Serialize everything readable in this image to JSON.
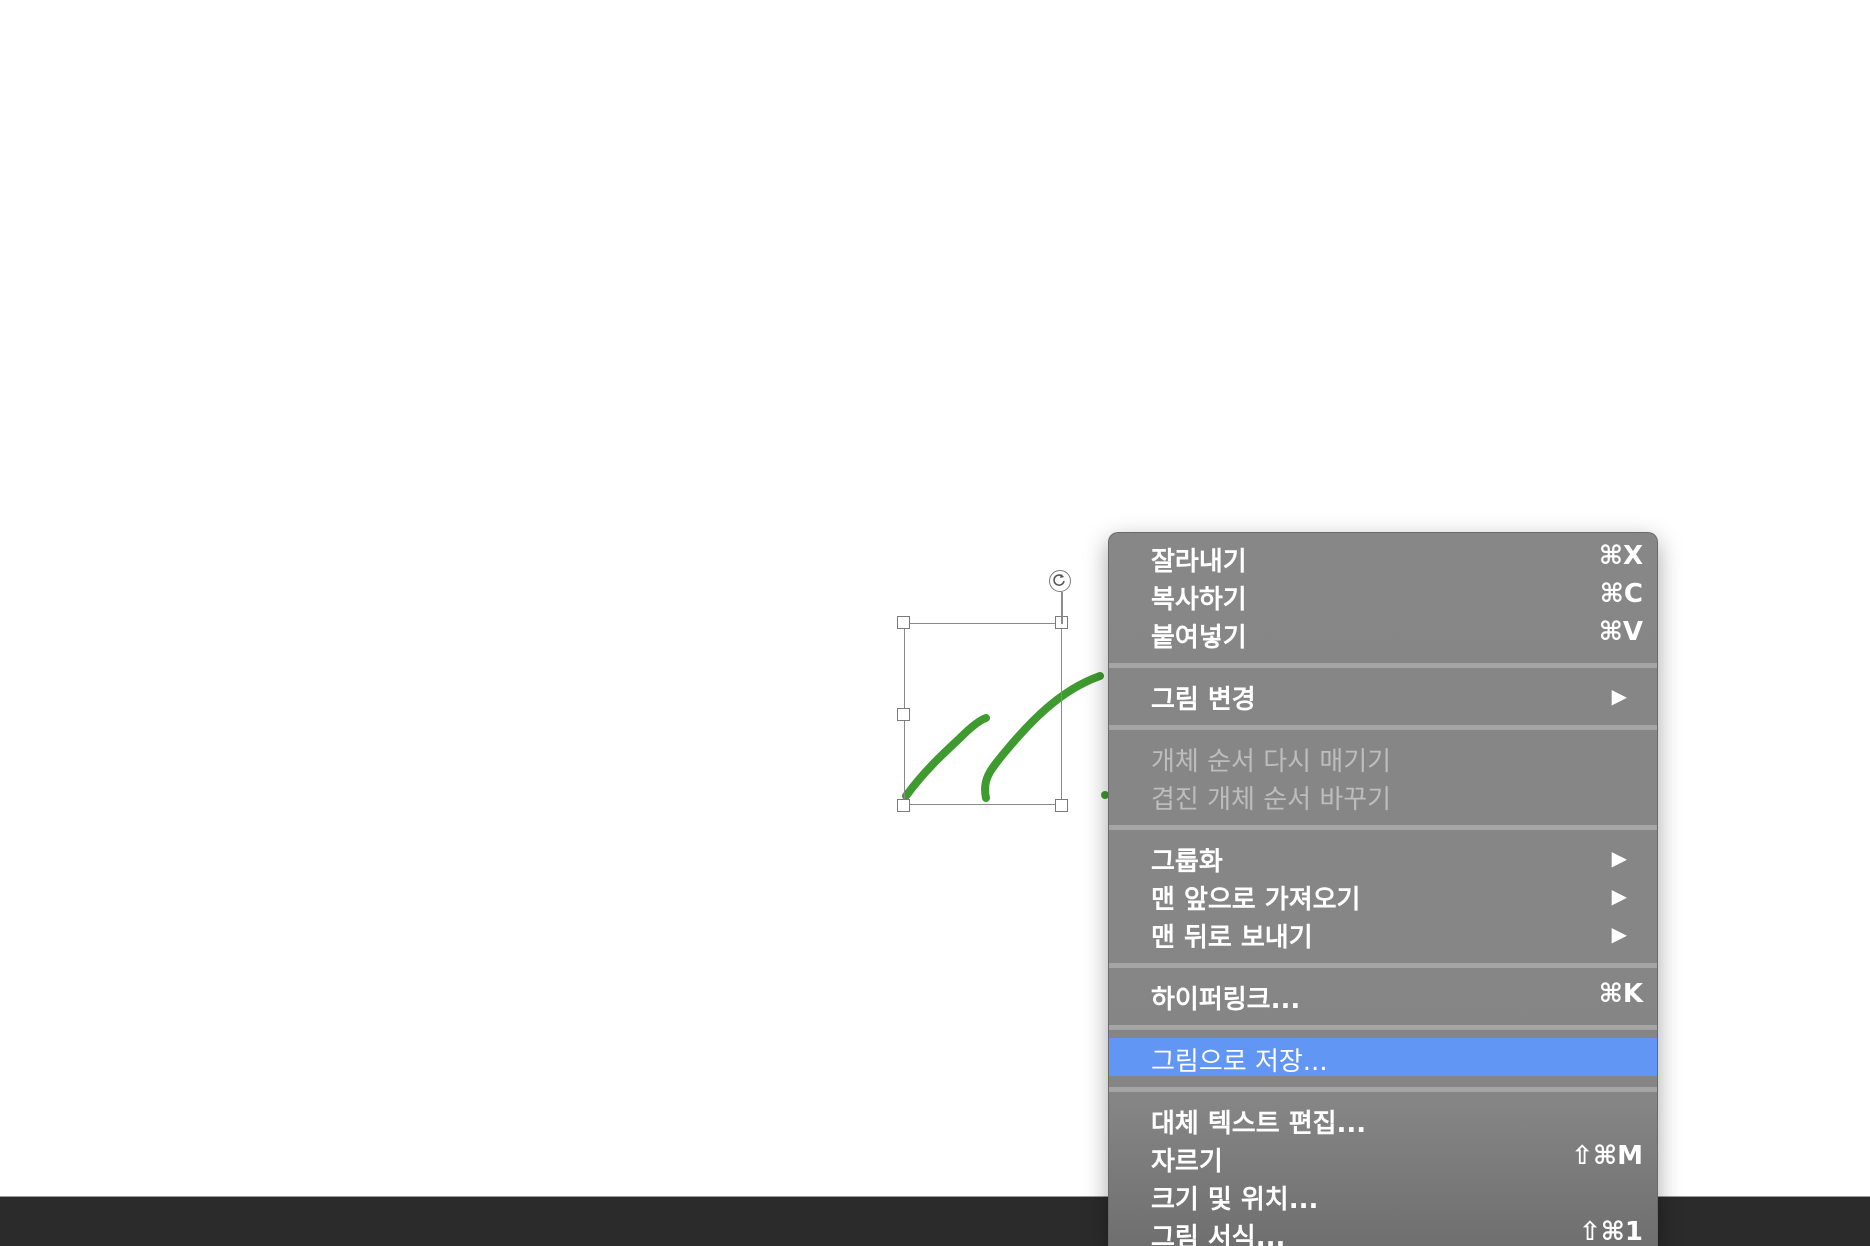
{
  "context_menu": {
    "items": [
      {
        "label": "잘라내기",
        "shortcut": "⌘X"
      },
      {
        "label": "복사하기",
        "shortcut": "⌘C"
      },
      {
        "label": "붙여넣기",
        "shortcut": "⌘V"
      },
      {
        "label": "그림 변경",
        "submenu": "▶"
      },
      {
        "label": "개체 순서 다시 매기기",
        "disabled": true
      },
      {
        "label": "겹진 개체 순서 바꾸기",
        "disabled": true
      },
      {
        "label": "그룹화",
        "submenu": "▶"
      },
      {
        "label": "맨 앞으로 가져오기",
        "submenu": "▶"
      },
      {
        "label": "맨 뒤로 보내기",
        "submenu": "▶"
      },
      {
        "label": "하이퍼링크...",
        "shortcut": "⌘K"
      },
      {
        "label": "그림으로 저장...",
        "highlighted": true
      },
      {
        "label": "대체 텍스트 편집..."
      },
      {
        "label": "자르기",
        "shortcut": "⇧⌘M"
      },
      {
        "label": "크기 및 위치..."
      },
      {
        "label": "그림 서식...",
        "shortcut": "⇧⌘1"
      }
    ],
    "highlight_color": "#6196f4"
  },
  "drawing": {
    "ink_color": "#3f9a2f"
  },
  "icons": {
    "rotate": "rotate-handle-icon"
  }
}
